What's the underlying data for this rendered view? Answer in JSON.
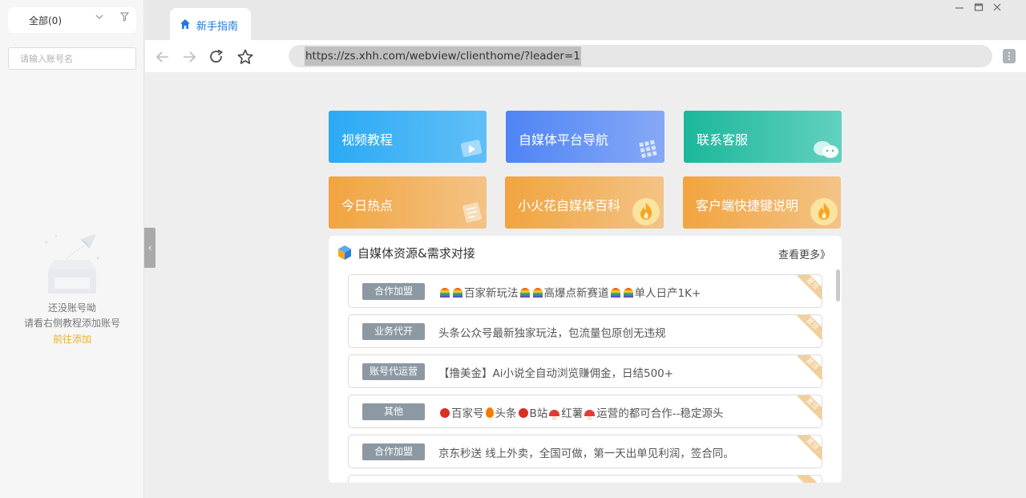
{
  "sidebar": {
    "filter_label": "全部(0)",
    "search_placeholder": "请输入账号名",
    "empty_line1": "还没账号呦",
    "empty_line2": "请看右侧教程添加账号",
    "empty_link": "前往添加"
  },
  "browser": {
    "tab_label": "新手指南",
    "url": "https://zs.xhh.com/webview/clienthome/?leader=1"
  },
  "colors": {
    "tab_accent": "#1f7ae0",
    "link_yellow": "#f0b020",
    "badge_gray": "#8c99a3"
  },
  "cards": [
    {
      "label": "视频教程",
      "icon": "play-icon"
    },
    {
      "label": "自媒体平台导航",
      "icon": "grid-icon"
    },
    {
      "label": "联系客服",
      "icon": "wechat-icon"
    },
    {
      "label": "今日热点",
      "icon": "document-icon"
    },
    {
      "label": "小火花自媒体百科",
      "icon": "fire-icon"
    },
    {
      "label": "客户端快捷键说明",
      "icon": "fire-icon"
    }
  ],
  "resources": {
    "title": "自媒体资源&需求对接",
    "more": "查看更多》",
    "corner_label": "置顶",
    "items": [
      {
        "tag": "合作加盟",
        "parts": [
          "百家新玩法",
          "高爆点新赛道",
          "单人日产1K+"
        ]
      },
      {
        "tag": "业务代开",
        "text": "头条公众号最新独家玩法，包流量包原创无违规"
      },
      {
        "tag": "账号代运营",
        "text": "【撸美金】Ai小说全自动浏览赚佣金，日结500+"
      },
      {
        "tag": "其他",
        "parts": [
          "百家号",
          "头条",
          "B站",
          "红薯",
          "运营的都可合作--稳定源头"
        ]
      },
      {
        "tag": "合作加盟",
        "text": "京东秒送 线上外卖，全国可做，第一天出单见利润，签合同。"
      }
    ]
  }
}
